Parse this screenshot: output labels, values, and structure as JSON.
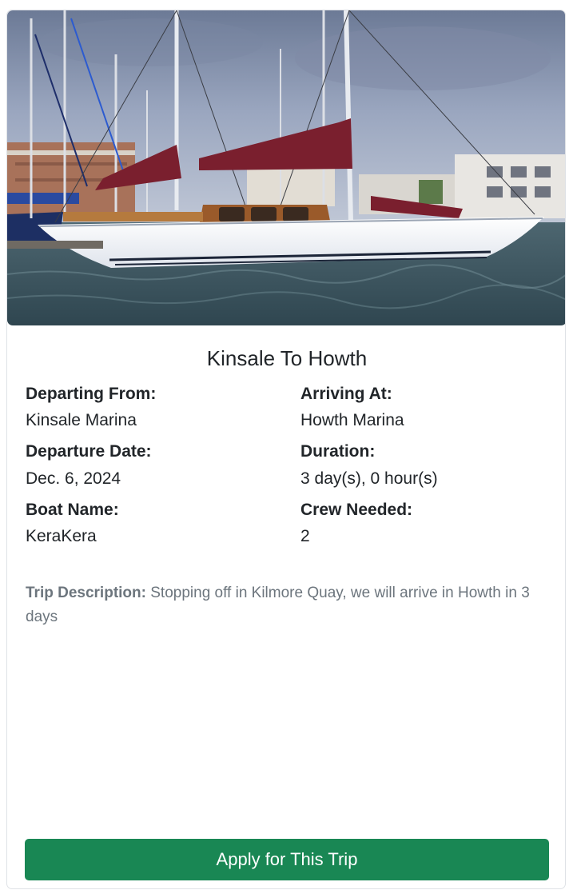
{
  "trip": {
    "image_alt": "Sailboat moored at a marina",
    "title": "Kinsale To Howth",
    "fields": {
      "departing_from_label": "Departing From:",
      "departing_from_value": "Kinsale Marina",
      "arriving_at_label": "Arriving At:",
      "arriving_at_value": "Howth Marina",
      "departure_date_label": "Departure Date:",
      "departure_date_value": "Dec. 6, 2024",
      "duration_label": "Duration:",
      "duration_value": "3 day(s), 0 hour(s)",
      "boat_name_label": "Boat Name:",
      "boat_name_value": "KeraKera",
      "crew_needed_label": "Crew Needed:",
      "crew_needed_value": "2"
    },
    "description_label": "Trip Description:",
    "description_text": "Stopping off in Kilmore Quay, we will arrive in Howth in 3 days",
    "apply_label": "Apply for This Trip"
  },
  "colors": {
    "button_green": "#198754",
    "text_dark": "#212529",
    "text_muted": "#6c757d",
    "hull_white": "#f3f5f8",
    "sail_cover_red": "#7a1f2e"
  }
}
